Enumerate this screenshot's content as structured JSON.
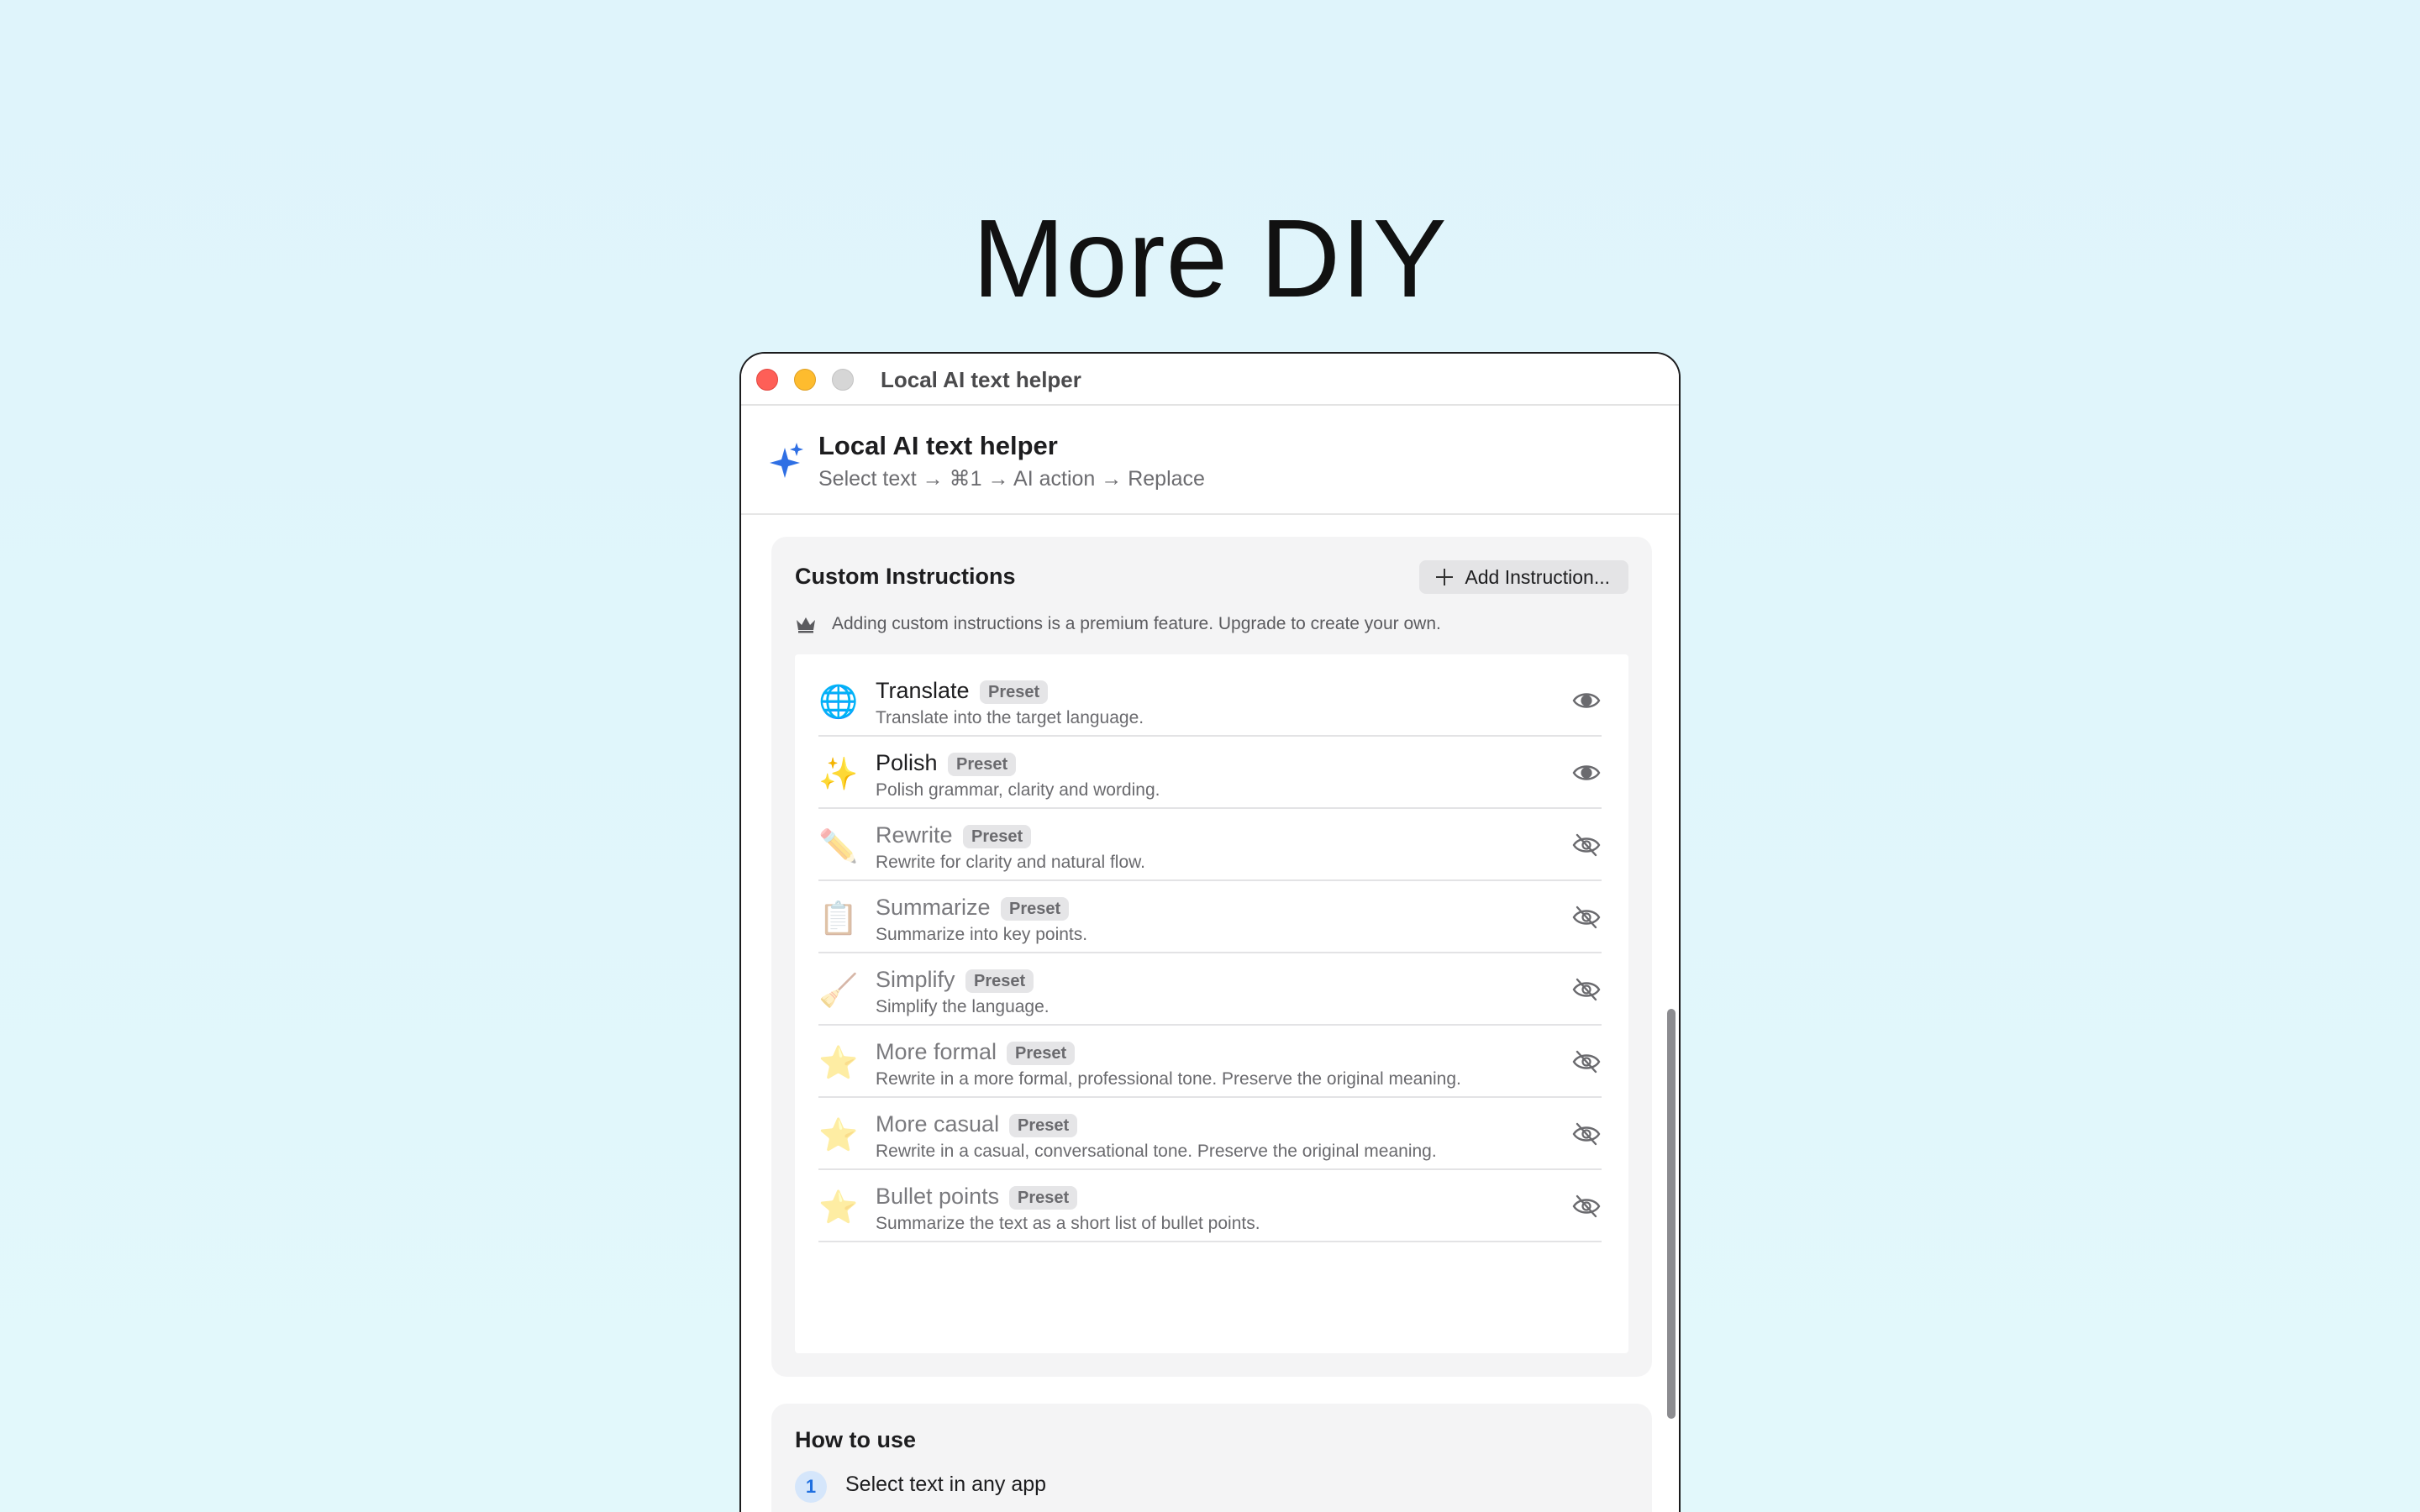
{
  "headline": "More DIY",
  "window": {
    "title": "Local AI text helper"
  },
  "app": {
    "icon": "sparkles-icon",
    "accent": "#2f6fe4",
    "title": "Local AI text helper",
    "subtitle": "Select text → ⌘1 → AI action → Replace"
  },
  "custom": {
    "title": "Custom Instructions",
    "add_label": "Add Instruction...",
    "notice": "Adding custom instructions is a premium feature. Upgrade to create your own.",
    "items": [
      {
        "emoji": "🌐",
        "name": "Translate",
        "badge": "Preset",
        "desc": "Translate into the target language.",
        "visible": true
      },
      {
        "emoji": "✨",
        "name": "Polish",
        "badge": "Preset",
        "desc": "Polish grammar, clarity and wording.",
        "visible": true
      },
      {
        "emoji": "✏️",
        "name": "Rewrite",
        "badge": "Preset",
        "desc": "Rewrite for clarity and natural flow.",
        "visible": false
      },
      {
        "emoji": "📋",
        "name": "Summarize",
        "badge": "Preset",
        "desc": "Summarize into key points.",
        "visible": false
      },
      {
        "emoji": "🧹",
        "name": "Simplify",
        "badge": "Preset",
        "desc": "Simplify the language.",
        "visible": false
      },
      {
        "emoji": "⭐",
        "name": "More formal",
        "badge": "Preset",
        "desc": "Rewrite in a more formal, professional tone. Preserve the original meaning.",
        "visible": false
      },
      {
        "emoji": "⭐",
        "name": "More casual",
        "badge": "Preset",
        "desc": "Rewrite in a casual, conversational tone. Preserve the original meaning.",
        "visible": false
      },
      {
        "emoji": "⭐",
        "name": "Bullet points",
        "badge": "Preset",
        "desc": "Summarize the text as a short list of bullet points.",
        "visible": false
      }
    ]
  },
  "howto": {
    "title": "How to use",
    "steps": [
      {
        "num": "1",
        "text": "Select text in any app"
      }
    ]
  }
}
